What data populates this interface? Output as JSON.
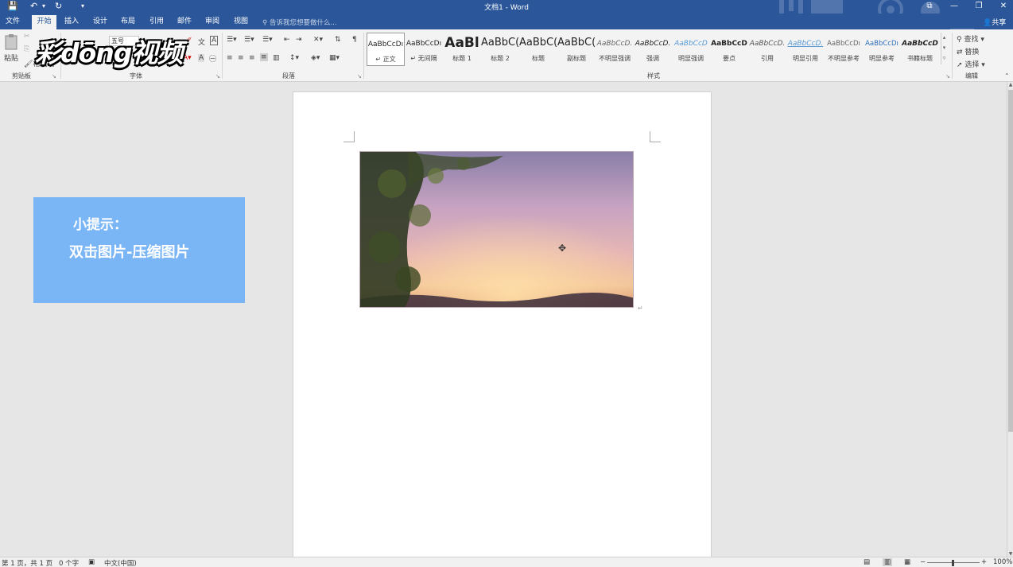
{
  "window": {
    "title": "文档1 - Word",
    "controls": [
      "⧉",
      "—",
      "❐",
      "✕"
    ]
  },
  "quick_access": {
    "save": "💾",
    "undo": "↶",
    "undo_drop": "▾",
    "redo": "↻",
    "customize": "▾"
  },
  "tabs": [
    "文件",
    "开始",
    "插入",
    "设计",
    "布局",
    "引用",
    "邮件",
    "审阅",
    "视图"
  ],
  "active_tab": "开始",
  "tell_me": {
    "placeholder": "告诉我您想要做什么..."
  },
  "share_label": "共享",
  "watermark": "彩dōng视频",
  "ribbon": {
    "clipboard": {
      "label": "剪贴板",
      "paste": "粘贴",
      "format_painter": "格式刷"
    },
    "font": {
      "label": "字体",
      "font_size": "五号"
    },
    "paragraph": {
      "label": "段落"
    },
    "styles": {
      "label": "样式",
      "items": [
        {
          "sample": "AaBbCcDı",
          "name": "↵ 正文"
        },
        {
          "sample": "AaBbCcDı",
          "name": "↵ 无间隔"
        },
        {
          "sample": "AaBl",
          "name": "标题 1"
        },
        {
          "sample": "AaBbC(",
          "name": "标题 2"
        },
        {
          "sample": "AaBbC(",
          "name": "标题"
        },
        {
          "sample": "AaBbC(",
          "name": "副标题"
        },
        {
          "sample": "AaBbCcD.",
          "name": "不明显强调"
        },
        {
          "sample": "AaBbCcD.",
          "name": "强调"
        },
        {
          "sample": "AaBbCcD",
          "name": "明显强调"
        },
        {
          "sample": "AaBbCcD",
          "name": "要点"
        },
        {
          "sample": "AaBbCcD.",
          "name": "引用"
        },
        {
          "sample": "AaBbCcD.",
          "name": "明显引用"
        },
        {
          "sample": "AaBbCcDı",
          "name": "不明显参考"
        },
        {
          "sample": "AaBbCcDı",
          "name": "明显参考"
        },
        {
          "sample": "AaBbCcD",
          "name": "书籍标题"
        }
      ]
    },
    "editing": {
      "label": "编辑",
      "find": "查找",
      "replace": "替换",
      "select": "选择"
    }
  },
  "tip": {
    "title": "小提示：",
    "text": "双击图片-压缩图片"
  },
  "status": {
    "page": "第 1 页，共 1 页",
    "words": "0 个字",
    "language": "中文(中国)",
    "zoom": "100%",
    "zoom_minus": "−",
    "zoom_plus": "+"
  },
  "colors": {
    "accent": "#2b579a",
    "tip_bg": "#7ab5f5"
  },
  "misc": {
    "para_mark": "↵"
  }
}
